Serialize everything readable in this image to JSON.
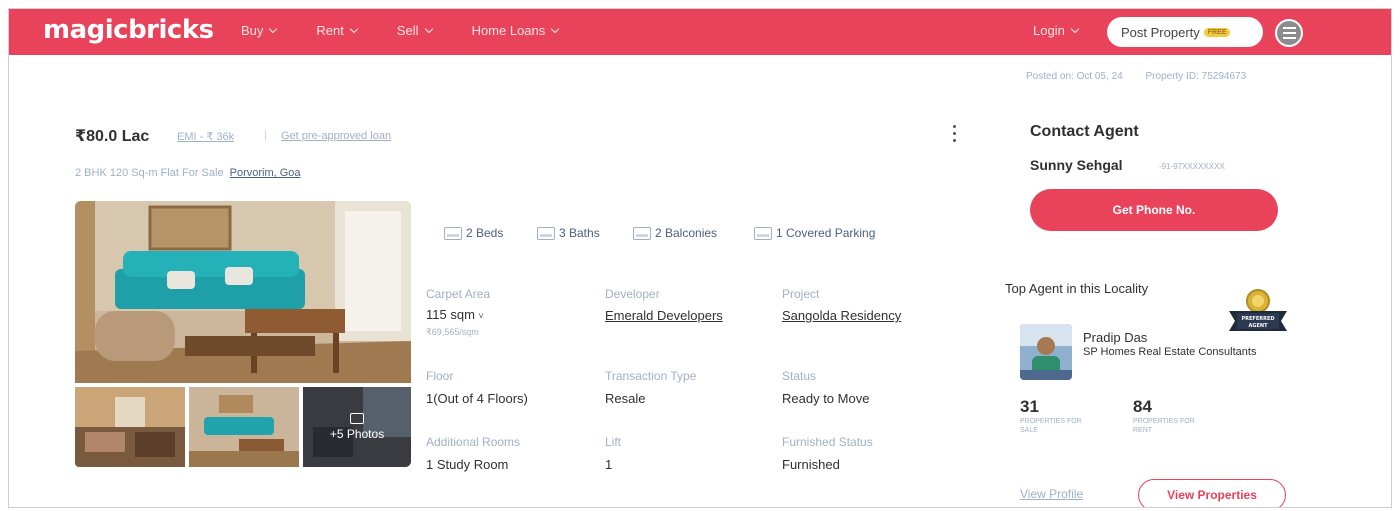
{
  "header": {
    "logo": "magicbricks",
    "nav": [
      {
        "label": "Buy"
      },
      {
        "label": "Rent"
      },
      {
        "label": "Sell"
      },
      {
        "label": "Home Loans"
      }
    ],
    "login": "Login",
    "post_property": "Post Property",
    "free_badge": "FREE"
  },
  "meta": {
    "posted_on": "Posted on: Oct 05, 24",
    "property_id": "Property ID: 75294673"
  },
  "listing": {
    "price": "₹80.0 Lac",
    "emi": "EMI - ₹ 36k",
    "separator": "|",
    "preapproved": "Get pre-approved loan",
    "subtitle": "2 BHK 120 Sq-m Flat For Sale",
    "locality": "Porvorim, Goa",
    "photos_more": "+5 Photos",
    "amenities": [
      {
        "label": "2 Beds",
        "icon": "bed-icon"
      },
      {
        "label": "3 Baths",
        "icon": "bath-icon"
      },
      {
        "label": "2 Balconies",
        "icon": "balcony-icon"
      },
      {
        "label": "1 Covered Parking",
        "icon": "parking-icon"
      }
    ],
    "details": {
      "carpet_area_label": "Carpet Area",
      "carpet_area_value": "115 sqm",
      "carpet_area_rate": "₹69,565/sqm",
      "developer_label": "Developer",
      "developer_value": "Emerald Developers",
      "project_label": "Project",
      "project_value": "Sangolda Residency",
      "floor_label": "Floor",
      "floor_value": "1(Out of 4 Floors)",
      "transaction_label": "Transaction Type",
      "transaction_value": "Resale",
      "status_label": "Status",
      "status_value": "Ready to Move",
      "rooms_label": "Additional Rooms",
      "rooms_value": "1 Study Room",
      "lift_label": "Lift",
      "lift_value": "1",
      "furnished_label": "Furnished Status",
      "furnished_value": "Furnished"
    }
  },
  "contact": {
    "title": "Contact Agent",
    "agent_name": "Sunny Sehgal",
    "agent_phone": "-91-97XXXXXXXX",
    "phone_button": "Get Phone No.",
    "top_agent_label": "Top Agent in this Locality",
    "badge_text_1": "PREFERRED",
    "badge_text_2": "AGENT",
    "top_agent_name": "Pradip Das",
    "top_agent_firm": "SP Homes Real Estate Consultants",
    "stats": [
      {
        "value": "31",
        "label": "PROPERTIES FOR SALE"
      },
      {
        "value": "84",
        "label": "PROPERTIES FOR RENT"
      }
    ],
    "view_profile": "View Profile",
    "view_properties": "View Properties"
  },
  "colors": {
    "brand": "#e8435a",
    "muted": "#9fb0c8",
    "text": "#303030"
  }
}
